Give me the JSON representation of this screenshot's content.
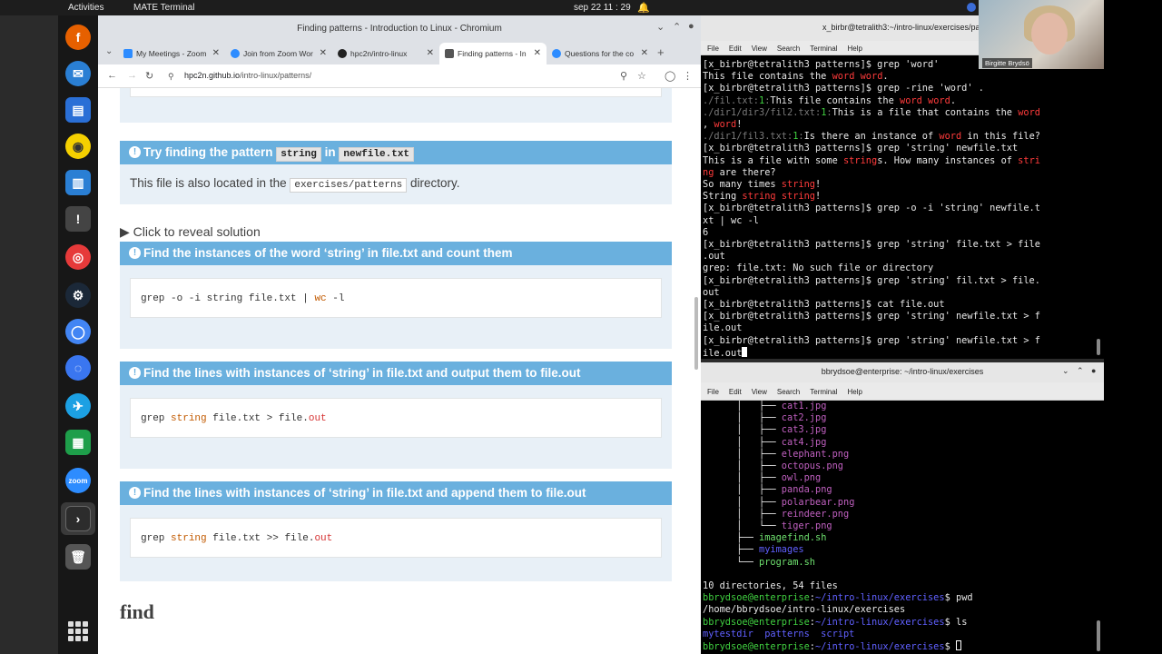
{
  "topbar": {
    "activities": "Activities",
    "app": "MATE Terminal",
    "clock": "sep 22  11 : 29"
  },
  "browser": {
    "title": "Finding patterns - Introduction to Linux - Chromium",
    "tabs": [
      {
        "label": "My Meetings - Zoom",
        "color": "#2d8cff"
      },
      {
        "label": "Join from Zoom Wor",
        "color": "#2d8cff"
      },
      {
        "label": "hpc2n/intro-linux",
        "color": "#222222"
      },
      {
        "label": "Finding patterns - In",
        "color": "#444444"
      },
      {
        "label": "Questions for the co",
        "color": "#2d8cff"
      }
    ],
    "url_host": "hpc2n.github.io",
    "url_path": "/intro-linux/patterns/",
    "admon1": {
      "title_pre": "Try finding the pattern",
      "code1": "string",
      "title_mid": "in",
      "code2": "newfile.txt",
      "body_pre": "This file is also located in the",
      "body_code": "exercises/patterns",
      "body_post": "directory."
    },
    "reveal": "Click to reveal solution",
    "sol1": {
      "title": "Find the instances of the word ‘string’ in file.txt and count them",
      "code_a": "grep -o -i string file.txt | ",
      "code_b": "wc",
      "code_c": " -l"
    },
    "sol2": {
      "title": "Find the lines with instances of ‘string’ in file.txt and output them to file.out",
      "code_a": "grep ",
      "code_b": "string",
      "code_c": " file.txt > file.",
      "code_d": "out"
    },
    "sol3": {
      "title": "Find the lines with instances of ‘string’ in file.txt and append them to file.out",
      "code_a": "grep ",
      "code_b": "string",
      "code_c": " file.txt >> file.",
      "code_d": "out"
    },
    "heading": "find"
  },
  "term1": {
    "title": "x_birbr@tetralith3:~/intro-linux/exercises/pat",
    "menu": [
      "File",
      "Edit",
      "View",
      "Search",
      "Terminal",
      "Help"
    ]
  },
  "term2": {
    "title": "bbrydsoe@enterprise: ~/intro-linux/exercises",
    "menu": [
      "File",
      "Edit",
      "View",
      "Search",
      "Terminal",
      "Help"
    ],
    "tree_files": [
      "cat1.jpg",
      "cat2.jpg",
      "cat3.jpg",
      "cat4.jpg",
      "elephant.png",
      "octopus.png",
      "owl.png",
      "panda.png",
      "polarbear.png",
      "reindeer.png",
      "tiger.png"
    ],
    "summary": "10 directories, 54 files",
    "prompt": "bbrydsoe@enterprise:~/intro-linux/exercises$",
    "pwd_out": "/home/bbrydsoe/intro-linux/exercises",
    "ls_out": "mytestdir  patterns  script"
  },
  "webcam": {
    "name": "Birgitte Brydsö"
  }
}
